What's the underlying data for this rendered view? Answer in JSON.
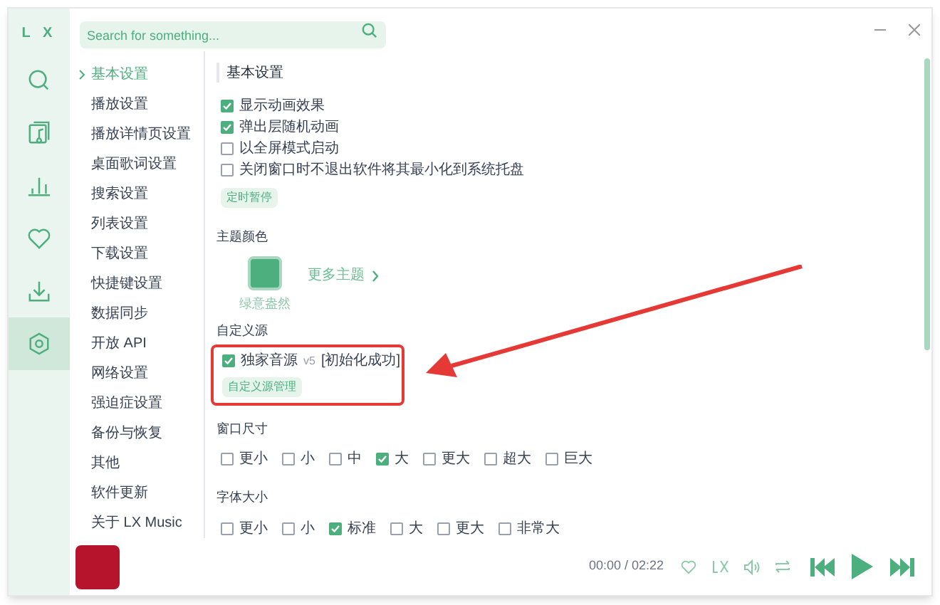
{
  "logo": "L X",
  "search": {
    "placeholder": "Search for something..."
  },
  "nav_icons": [
    {
      "kind": "search",
      "selected": false
    },
    {
      "kind": "music",
      "selected": false
    },
    {
      "kind": "chart",
      "selected": false
    },
    {
      "kind": "heart",
      "selected": false
    },
    {
      "kind": "download",
      "selected": false
    },
    {
      "kind": "settings",
      "selected": true
    }
  ],
  "settings_nav": [
    {
      "label": "基本设置",
      "selected": true
    },
    {
      "label": "播放设置",
      "selected": false
    },
    {
      "label": "播放详情页设置",
      "selected": false
    },
    {
      "label": "桌面歌词设置",
      "selected": false
    },
    {
      "label": "搜索设置",
      "selected": false
    },
    {
      "label": "列表设置",
      "selected": false
    },
    {
      "label": "下载设置",
      "selected": false
    },
    {
      "label": "快捷键设置",
      "selected": false
    },
    {
      "label": "数据同步",
      "selected": false
    },
    {
      "label": "开放 API",
      "selected": false
    },
    {
      "label": "网络设置",
      "selected": false
    },
    {
      "label": "强迫症设置",
      "selected": false
    },
    {
      "label": "备份与恢复",
      "selected": false
    },
    {
      "label": "其他",
      "selected": false
    },
    {
      "label": "软件更新",
      "selected": false
    },
    {
      "label": "关于 LX Music",
      "selected": false
    }
  ],
  "basic": {
    "title": "基本设置",
    "options": [
      {
        "label": "显示动画效果",
        "checked": true
      },
      {
        "label": "弹出层随机动画",
        "checked": true
      },
      {
        "label": "以全屏模式启动",
        "checked": false
      },
      {
        "label": "关闭窗口时不退出软件将其最小化到系统托盘",
        "checked": false
      }
    ],
    "button": "定时暂停"
  },
  "theme": {
    "heading": "主题颜色",
    "current": {
      "label": "绿意盎然",
      "color": "#4caf7d"
    },
    "more": "更多主题"
  },
  "custom_source": {
    "heading": "自定义源",
    "source": {
      "name": "独家音源",
      "version": "v5",
      "status": "[初始化成功]",
      "checked": true
    },
    "button": "自定义源管理"
  },
  "window_size": {
    "heading": "窗口尺寸",
    "options": [
      {
        "label": "更小",
        "checked": false
      },
      {
        "label": "小",
        "checked": false
      },
      {
        "label": "中",
        "checked": false
      },
      {
        "label": "大",
        "checked": true
      },
      {
        "label": "更大",
        "checked": false
      },
      {
        "label": "超大",
        "checked": false
      },
      {
        "label": "巨大",
        "checked": false
      }
    ]
  },
  "font_size": {
    "heading": "字体大小",
    "options": [
      {
        "label": "更小",
        "checked": false
      },
      {
        "label": "小",
        "checked": false
      },
      {
        "label": "标准",
        "checked": true
      },
      {
        "label": "大",
        "checked": false
      },
      {
        "label": "更大",
        "checked": false
      },
      {
        "label": "非常大",
        "checked": false
      }
    ]
  },
  "player": {
    "time": "00:00 / 02:22"
  }
}
